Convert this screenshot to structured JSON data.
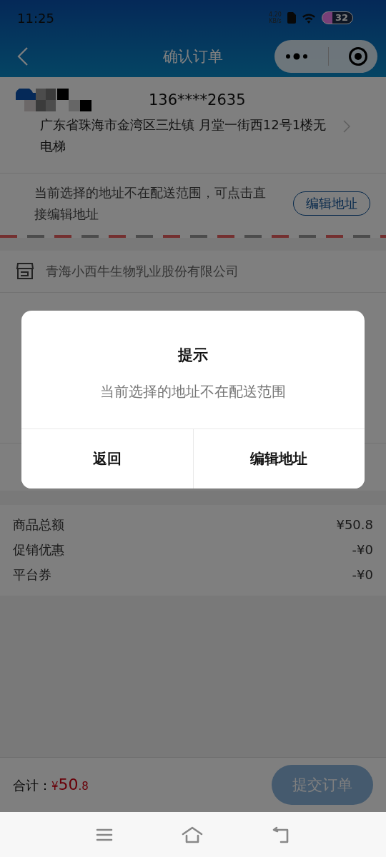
{
  "status_bar": {
    "time": "11:25",
    "net_speed": "4.20",
    "net_unit": "KB/s",
    "battery": "32"
  },
  "nav": {
    "title": "确认订单"
  },
  "address": {
    "phone": "136****2635",
    "line": "广东省珠海市金湾区三灶镇 月堂一街西12号1楼无电梯"
  },
  "notice": {
    "text": "当前选择的地址不在配送范围，可点击直接编辑地址",
    "button": "编辑地址"
  },
  "store": {
    "name": "青海小西牛生物乳业股份有限公司"
  },
  "summary": [
    {
      "label": "商品总额",
      "value": "¥50.8"
    },
    {
      "label": "促销优惠",
      "value": "-¥0"
    },
    {
      "label": "平台券",
      "value": "-¥0"
    }
  ],
  "footer": {
    "total_label": "合计：",
    "currency": "¥",
    "amount": "50",
    "decimals": ".8",
    "submit": "提交订单"
  },
  "dialog": {
    "title": "提示",
    "message": "当前选择的地址不在配送范围",
    "buttons": [
      "返回",
      "编辑地址"
    ]
  }
}
